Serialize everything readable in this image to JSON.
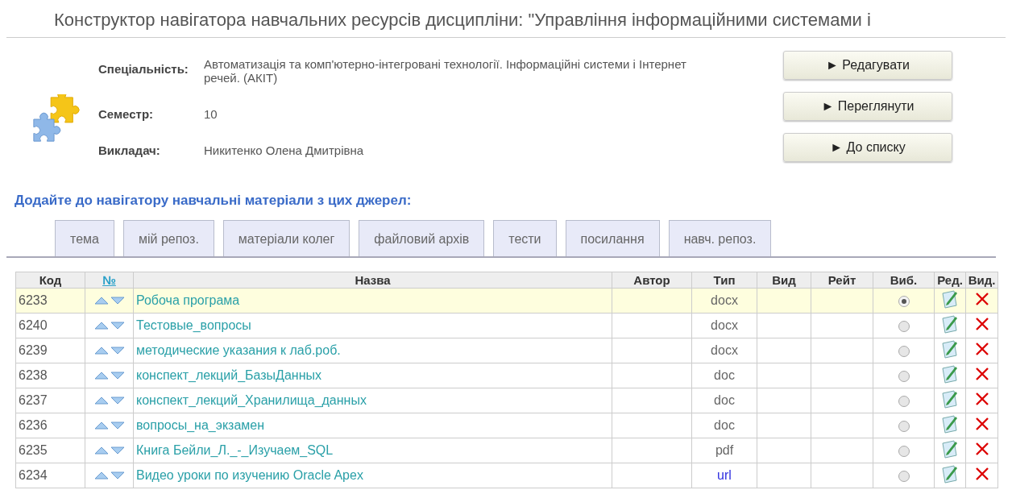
{
  "title": "Конструктор навігатора навчальних ресурсів дисципліни: \"Управління інформаційними системами і",
  "info": [
    {
      "label": "Спеціальність:",
      "value": "Автоматизація та комп'ютерно-інтегровані технології. Інформаційні системи і Інтернет речей. (АКІТ)"
    },
    {
      "label": "Семестр:",
      "value": "10"
    },
    {
      "label": "Викладач:",
      "value": "Никитенко Олена Дмитрівна"
    }
  ],
  "buttons": [
    "► Редагувати",
    "► Переглянути",
    "► До списку"
  ],
  "sources_heading": "Додайте до навігатору навчальні матеріали з цих джерел:",
  "tabs": [
    {
      "label": "тема",
      "selected": false
    },
    {
      "label": "мій репоз.",
      "selected": false
    },
    {
      "label": "матеріали колег",
      "selected": false
    },
    {
      "label": "файловий архів",
      "selected": false
    },
    {
      "label": "тести",
      "selected": false
    },
    {
      "label": "посилання",
      "selected": false
    },
    {
      "label": "навч. репоз.",
      "selected": false
    }
  ],
  "table": {
    "columns": [
      "Код",
      "№",
      "Назва",
      "Автор",
      "Тип",
      "Вид",
      "Рейт",
      "Виб.",
      "Ред.",
      "Вид."
    ],
    "rows": [
      {
        "code": "6233",
        "name": "Робоча програма",
        "type": "docx",
        "type_link": false,
        "selected": true
      },
      {
        "code": "6240",
        "name": "Тестовые_вопросы",
        "type": "docx",
        "type_link": false,
        "selected": false
      },
      {
        "code": "6239",
        "name": "методические указания к лаб.роб.",
        "type": "docx",
        "type_link": false,
        "selected": false
      },
      {
        "code": "6238",
        "name": "конспект_лекций_БазыДанных",
        "type": "doc",
        "type_link": false,
        "selected": false
      },
      {
        "code": "6237",
        "name": "конспект_лекций_Хранилища_данных",
        "type": "doc",
        "type_link": false,
        "selected": false
      },
      {
        "code": "6236",
        "name": "вопросы_на_экзамен",
        "type": "doc",
        "type_link": false,
        "selected": false
      },
      {
        "code": "6235",
        "name": "Книга Бейли_Л._-_Изучаем_SQL",
        "type": "pdf",
        "type_link": false,
        "selected": false
      },
      {
        "code": "6234",
        "name": "Видео уроки по изучению Oracle Apex",
        "type": "url",
        "type_link": true,
        "selected": false
      }
    ]
  }
}
